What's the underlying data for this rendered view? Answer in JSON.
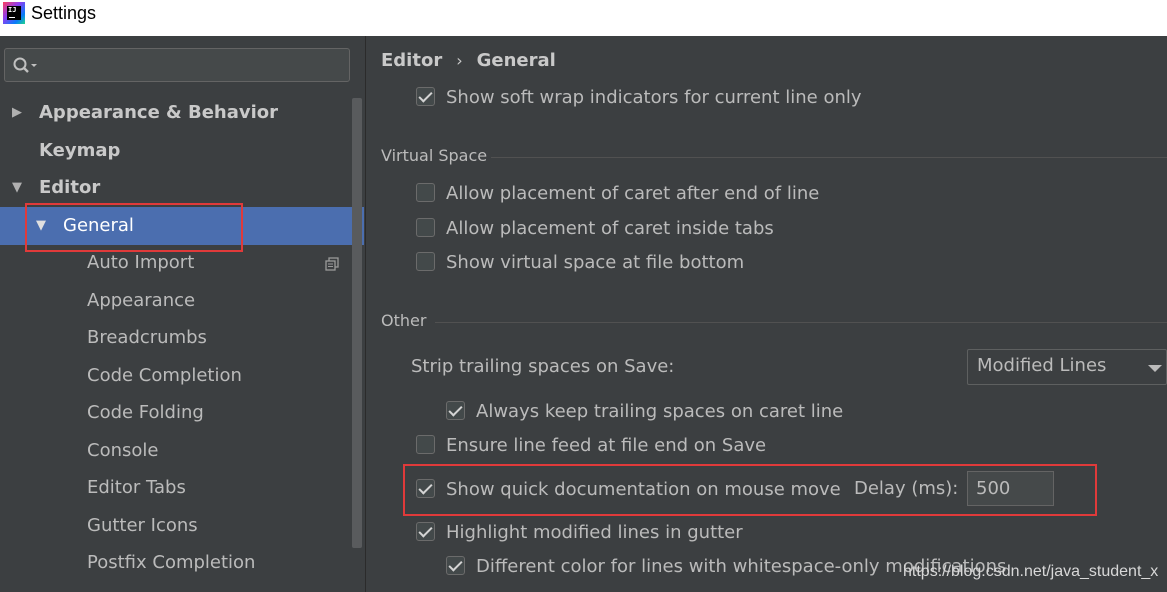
{
  "window": {
    "title": "Settings",
    "app_icon_text": "IJ"
  },
  "sidebar": {
    "search": {
      "value": "",
      "placeholder": ""
    },
    "items": [
      {
        "label": "Appearance & Behavior",
        "expanded": false,
        "bold": true
      },
      {
        "label": "Keymap",
        "bold": true
      },
      {
        "label": "Editor",
        "expanded": true,
        "bold": true
      },
      {
        "label": "General",
        "expanded": true,
        "selected": true
      },
      {
        "label": "Auto Import",
        "icon": "copy-settings-icon"
      },
      {
        "label": "Appearance"
      },
      {
        "label": "Breadcrumbs"
      },
      {
        "label": "Code Completion"
      },
      {
        "label": "Code Folding"
      },
      {
        "label": "Console"
      },
      {
        "label": "Editor Tabs"
      },
      {
        "label": "Gutter Icons"
      },
      {
        "label": "Postfix Completion"
      }
    ]
  },
  "content": {
    "breadcrumb": {
      "parent": "Editor",
      "separator": "›",
      "current": "General"
    },
    "options": {
      "soft_wrap_current_line": {
        "label": "Show soft wrap indicators for current line only",
        "checked": true
      },
      "caret_after_end": {
        "label": "Allow placement of caret after end of line",
        "checked": false
      },
      "caret_inside_tabs": {
        "label": "Allow placement of caret inside tabs",
        "checked": false
      },
      "virtual_space_bottom": {
        "label": "Show virtual space at file bottom",
        "checked": false
      },
      "keep_trailing_spaces": {
        "label": "Always keep trailing spaces on caret line",
        "checked": true
      },
      "ensure_line_feed": {
        "label": "Ensure line feed at file end on Save",
        "checked": false
      },
      "quick_doc_mouse_move": {
        "label": "Show quick documentation on mouse move",
        "checked": true
      },
      "highlight_modified": {
        "label": "Highlight modified lines in gutter",
        "checked": true
      },
      "whitespace_color": {
        "label": "Different color for lines with whitespace-only modifications",
        "checked": true
      }
    },
    "sections": {
      "virtual_space": "Virtual Space",
      "other": "Other"
    },
    "strip_trailing": {
      "label": "Strip trailing spaces on Save:",
      "value": "Modified Lines"
    },
    "delay": {
      "label": "Delay (ms):",
      "value": "500"
    }
  },
  "watermark": "https://blog.csdn.net/java_student_x",
  "colors": {
    "background": "#3c3f41",
    "selection": "#4b6eaf",
    "highlight_box": "#e03a3a"
  }
}
